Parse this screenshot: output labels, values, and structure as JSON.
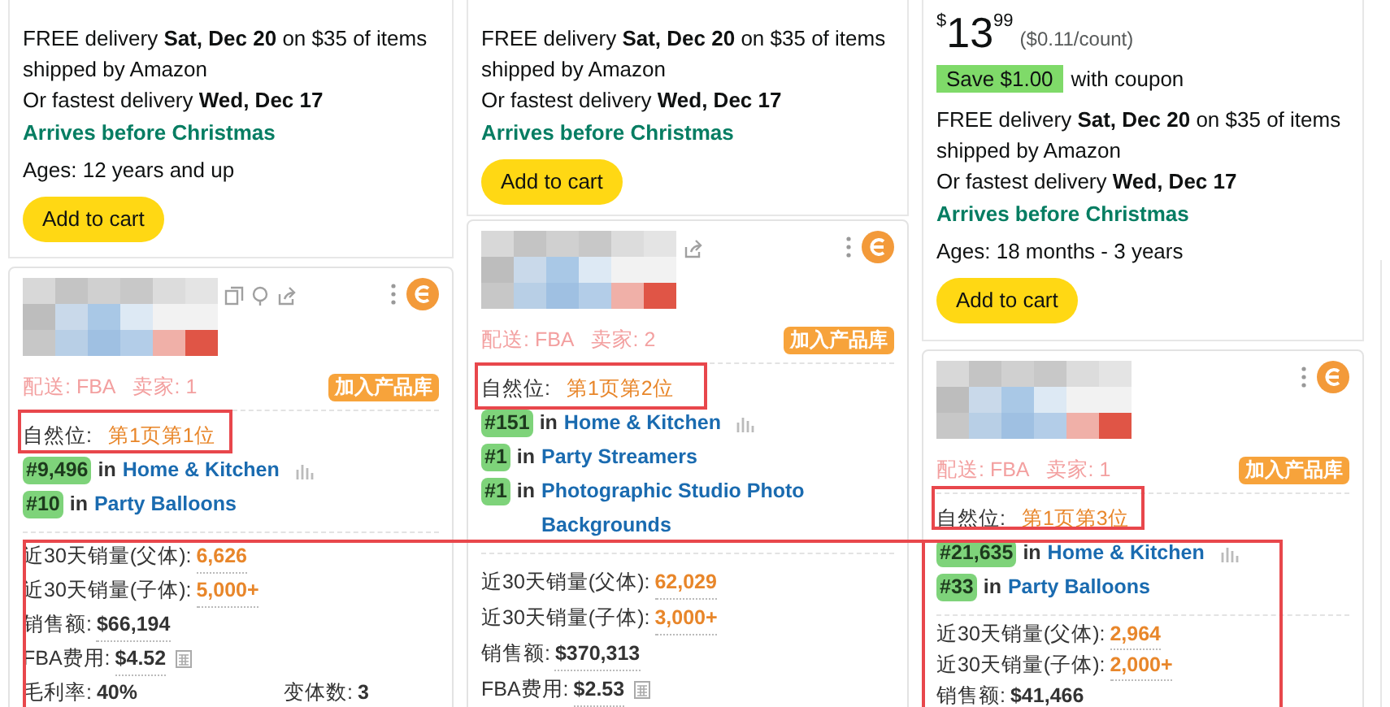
{
  "columns": [
    {
      "top_card": {
        "delivery": "FREE delivery **Sat, Dec 20** on $35 of items shipped by Amazon",
        "fastest": "Or fastest delivery **Wed, Dec 17**",
        "arrives": "Arrives before Christmas",
        "ages": "Ages: 12 years and up",
        "button": "Add to cart"
      },
      "plugin": {
        "shipping": "配送: FBA",
        "sellers": "卖家: 1",
        "add_button": "加入产品库",
        "organic_label": "自然位:",
        "organic_value": "第1页第1位",
        "ranks": [
          {
            "rank": "#9,496",
            "in": "in",
            "category": "Home & Kitchen"
          },
          {
            "rank": "#10",
            "in": "in",
            "category": "Party Balloons"
          }
        ],
        "stats": [
          {
            "items": [
              {
                "kind": "sales",
                "label": "近30天销量(父体):",
                "value": "6,626"
              }
            ]
          },
          {
            "items": [
              {
                "kind": "sales",
                "label": "近30天销量(子体):",
                "value": "5,000+"
              }
            ]
          },
          {
            "items": [
              {
                "kind": "money",
                "label": "销售额:",
                "value": "$66,194"
              }
            ]
          },
          {
            "items": [
              {
                "kind": "fee",
                "label": "FBA费用:",
                "value": "$4.52"
              }
            ]
          },
          {
            "items": [
              {
                "kind": "plain",
                "label": "毛利率:",
                "value": "40%"
              },
              {
                "kind": "plain",
                "label": "变体数:",
                "value": "3"
              }
            ]
          }
        ]
      }
    },
    {
      "top_card": {
        "delivery": "FREE delivery **Sat, Dec 20** on $35 of items shipped by Amazon",
        "fastest": "Or fastest delivery **Wed, Dec 17**",
        "arrives": "Arrives before Christmas",
        "button": "Add to cart"
      },
      "plugin": {
        "shipping": "配送: FBA",
        "sellers": "卖家: 2",
        "add_button": "加入产品库",
        "organic_label": "自然位:",
        "organic_value": "第1页第2位",
        "ranks": [
          {
            "rank": "#151",
            "in": "in",
            "category": "Home & Kitchen"
          },
          {
            "rank": "#1",
            "in": "in",
            "category": "Party Streamers"
          },
          {
            "rank": "#1",
            "in": "in",
            "category": "Photographic Studio Photo Backgrounds"
          }
        ],
        "stats": [
          {
            "items": [
              {
                "kind": "sales",
                "label": "近30天销量(父体):",
                "value": "62,029"
              }
            ]
          },
          {
            "items": [
              {
                "kind": "sales",
                "label": "近30天销量(子体):",
                "value": "3,000+"
              }
            ]
          },
          {
            "items": [
              {
                "kind": "money",
                "label": "销售额:",
                "value": "$370,313"
              }
            ]
          },
          {
            "items": [
              {
                "kind": "fee",
                "label": "FBA费用:",
                "value": "$2.53"
              }
            ]
          }
        ]
      }
    },
    {
      "top_card": {
        "price": {
          "currency": "$",
          "whole": "13",
          "fraction": "99",
          "unit": "($0.11/count)"
        },
        "coupon": {
          "badge": "Save $1.00",
          "text": "with coupon"
        },
        "delivery": "FREE delivery **Sat, Dec 20** on $35 of items shipped by Amazon",
        "fastest": "Or fastest delivery **Wed, Dec 17**",
        "arrives": "Arrives before Christmas",
        "ages": "Ages: 18 months - 3 years",
        "button": "Add to cart"
      },
      "plugin": {
        "shipping": "配送: FBA",
        "sellers": "卖家: 1",
        "add_button": "加入产品库",
        "organic_label": "自然位:",
        "organic_value": "第1页第3位",
        "ranks": [
          {
            "rank": "#21,635",
            "in": "in",
            "category": "Home & Kitchen"
          },
          {
            "rank": "#33",
            "in": "in",
            "category": "Party Balloons"
          }
        ],
        "stats": [
          {
            "items": [
              {
                "kind": "sales",
                "label": "近30天销量(父体):",
                "value": "2,964"
              }
            ]
          },
          {
            "items": [
              {
                "kind": "sales",
                "label": "近30天销量(子体):",
                "value": "2,000+"
              }
            ]
          },
          {
            "items": [
              {
                "kind": "money",
                "label": "销售额:",
                "value": "$41,466"
              }
            ]
          }
        ]
      }
    }
  ]
}
